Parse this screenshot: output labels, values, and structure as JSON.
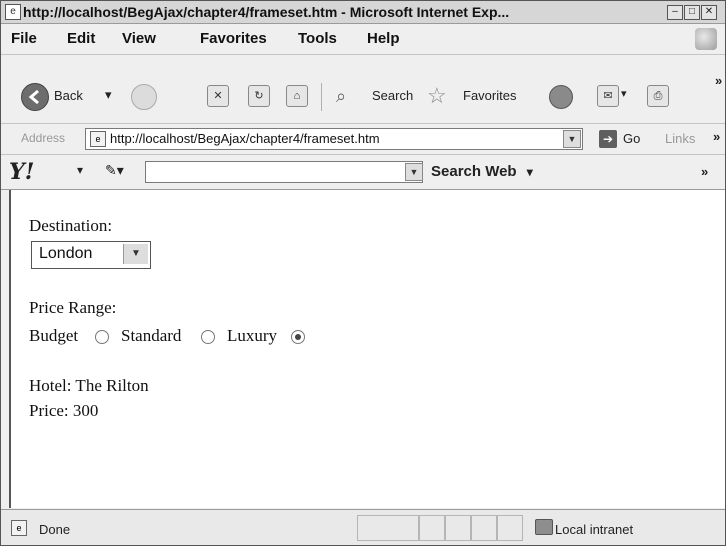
{
  "window": {
    "title": "http://localhost/BegAjax/chapter4/frameset.htm - Microsoft Internet Exp...",
    "controls": [
      "minimize",
      "maximize",
      "close"
    ]
  },
  "menu": {
    "items": [
      "File",
      "Edit",
      "View",
      "Favorites",
      "Tools",
      "Help"
    ]
  },
  "toolbar": {
    "back_label": "Back",
    "search_label": "Search",
    "favorites_label": "Favorites",
    "overflow": "»"
  },
  "address": {
    "label": "Address",
    "url": "http://localhost/BegAjax/chapter4/frameset.htm",
    "go_label": "Go",
    "links_label": "Links",
    "overflow": "»"
  },
  "yahoo": {
    "logo": "Y!",
    "search_value": "",
    "search_web_label": "Search Web",
    "overflow": "»"
  },
  "page": {
    "destination_label": "Destination:",
    "destination_value": "London",
    "price_range_label": "Price Range:",
    "options": [
      {
        "label": "Budget",
        "selected": false
      },
      {
        "label": "Standard",
        "selected": false
      },
      {
        "label": "Luxury",
        "selected": true
      }
    ],
    "hotel_text": "Hotel: The Rilton",
    "price_text": "Price: 300"
  },
  "status": {
    "text": "Done",
    "zone": "Local intranet"
  },
  "icons": [
    "ie-page-icon",
    "back-arrow-icon",
    "forward-arrow-icon",
    "stop-icon",
    "refresh-icon",
    "home-icon",
    "search-icon",
    "favorites-star-icon",
    "history-icon",
    "mail-icon",
    "print-icon",
    "page-icon",
    "go-arrow-icon",
    "pencil-icon",
    "windows-logo-icon",
    "intranet-icon"
  ]
}
